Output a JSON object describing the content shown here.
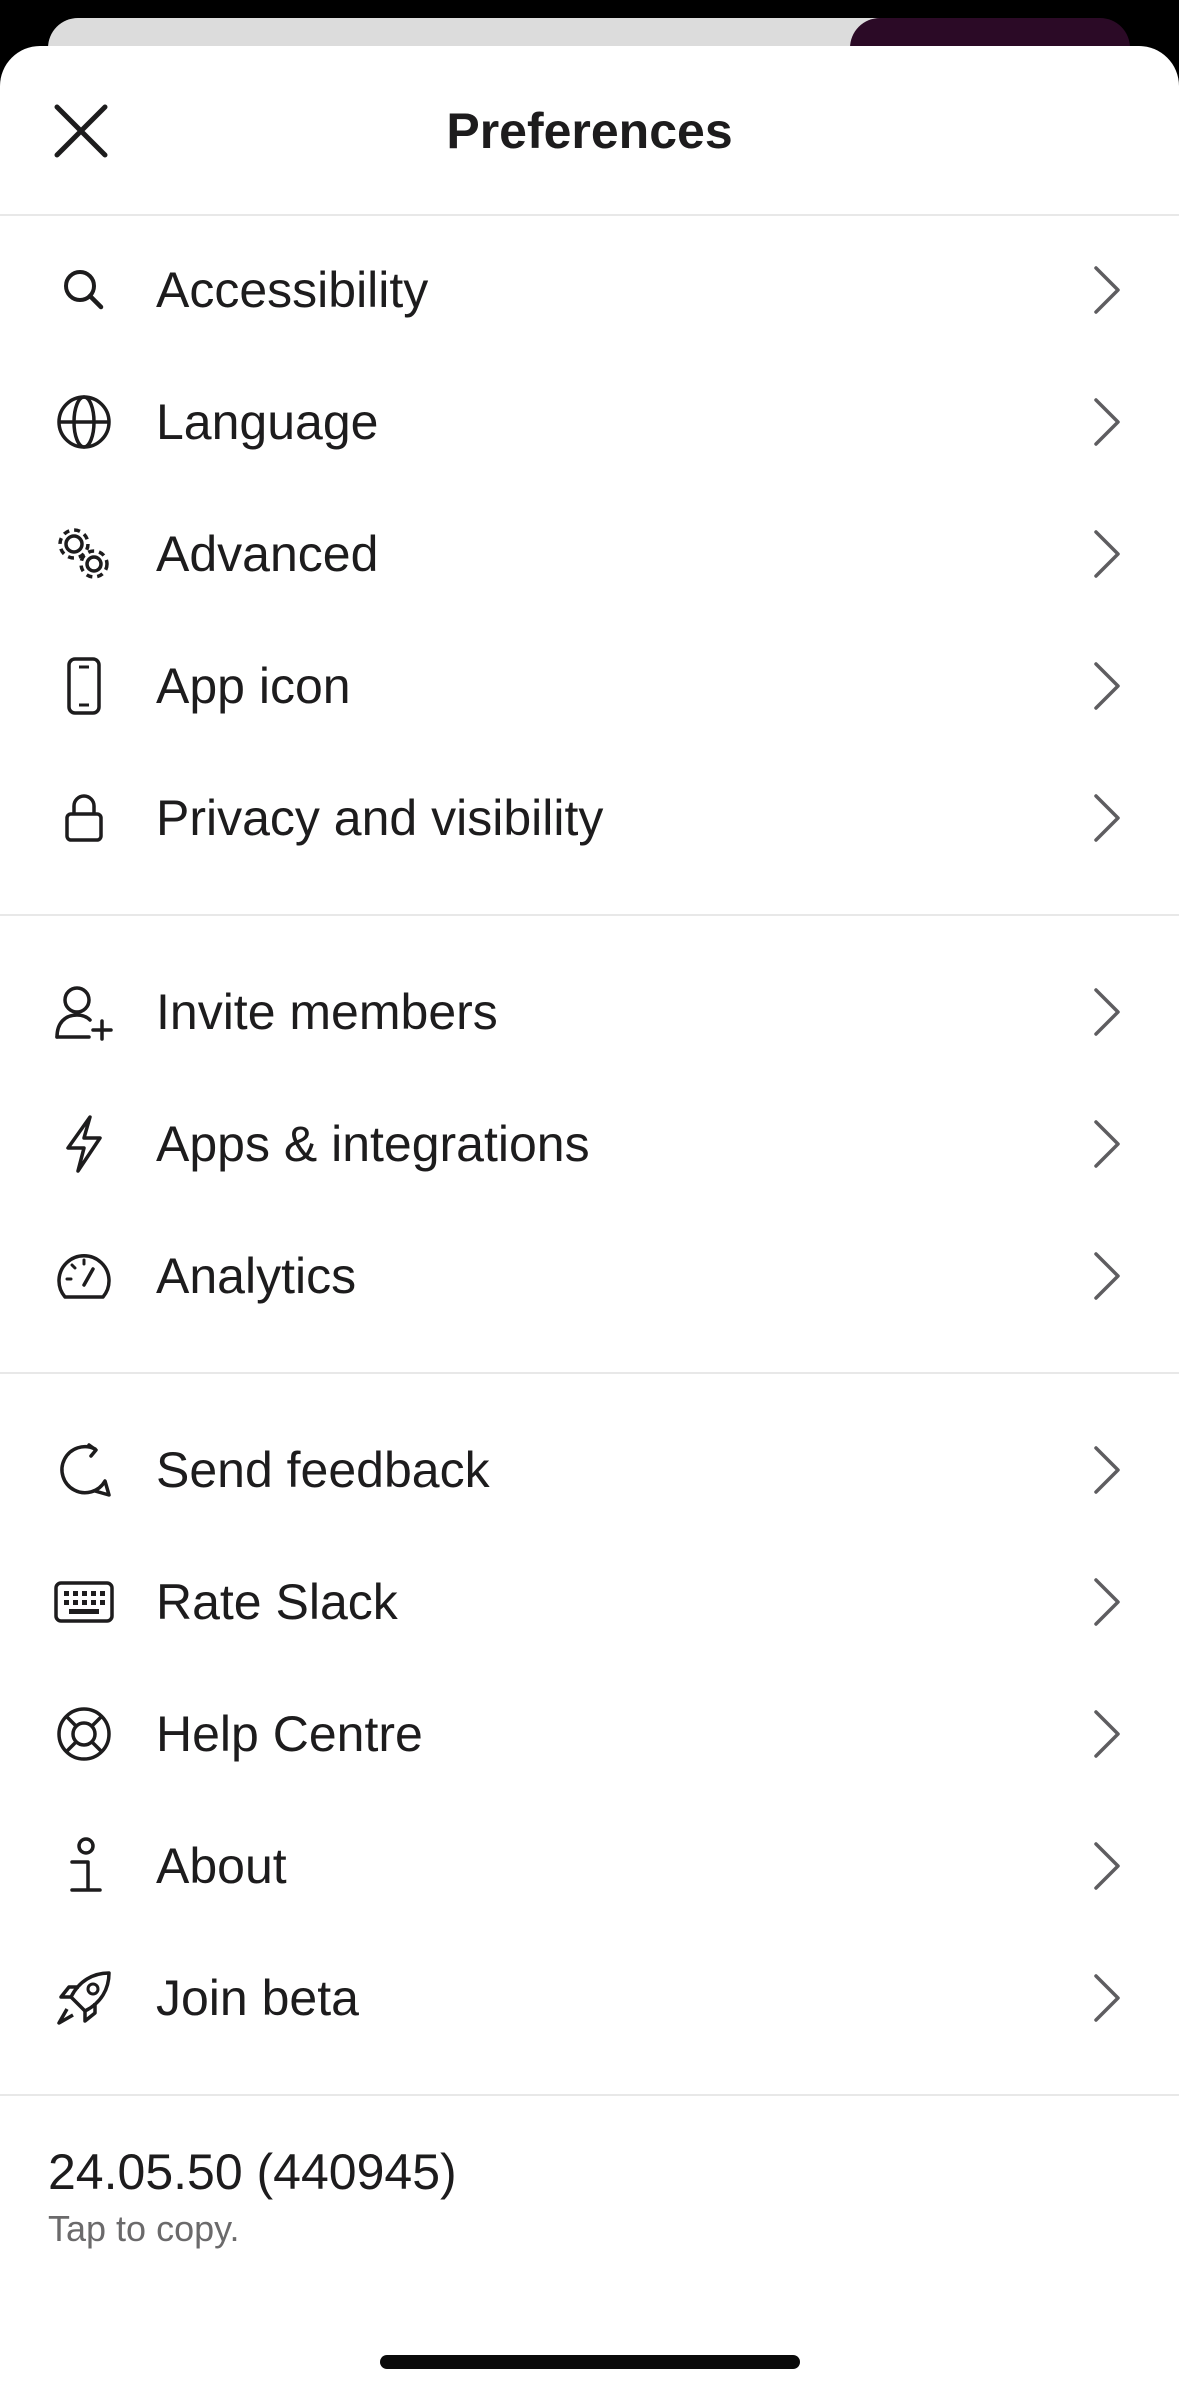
{
  "header": {
    "title": "Preferences",
    "close_icon": "close-icon"
  },
  "groups": [
    {
      "items": [
        {
          "label": "Accessibility",
          "icon": "search-icon"
        },
        {
          "label": "Language",
          "icon": "globe-icon"
        },
        {
          "label": "Advanced",
          "icon": "gears-icon"
        },
        {
          "label": "App icon",
          "icon": "phone-icon"
        },
        {
          "label": "Privacy and visibility",
          "icon": "lock-icon"
        }
      ]
    },
    {
      "items": [
        {
          "label": "Invite members",
          "icon": "add-person-icon"
        },
        {
          "label": "Apps & integrations",
          "icon": "lightning-icon"
        },
        {
          "label": "Analytics",
          "icon": "gauge-icon"
        }
      ]
    },
    {
      "items": [
        {
          "label": "Send feedback",
          "icon": "feedback-icon"
        },
        {
          "label": "Rate Slack",
          "icon": "keyboard-icon"
        },
        {
          "label": "Help Centre",
          "icon": "lifebuoy-icon"
        },
        {
          "label": "About",
          "icon": "info-icon"
        },
        {
          "label": "Join beta",
          "icon": "rocket-icon"
        }
      ]
    }
  ],
  "footer": {
    "version": "24.05.50 (440945)",
    "hint": "Tap to copy."
  },
  "colors": {
    "text": "#1d1c1d",
    "secondary_text": "#6b6a6b",
    "divider": "#e8e8e8",
    "chevron": "#5e5d60"
  }
}
